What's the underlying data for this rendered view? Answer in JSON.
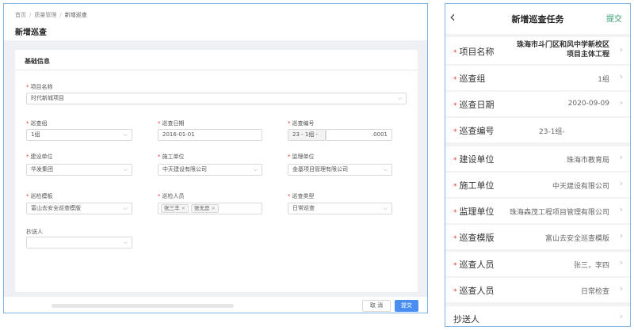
{
  "desktop": {
    "breadcrumb": [
      "首页",
      "质量管理",
      "新增巡查"
    ],
    "page_title": "新增巡查",
    "section_title": "基础信息",
    "fields": {
      "project": {
        "label": "项目名称",
        "value": "时代新城项目"
      },
      "group": {
        "label": "巡查组",
        "value": "1组"
      },
      "date": {
        "label": "巡查日期",
        "value": "2016-01-01"
      },
      "code": {
        "label": "巡查编号",
        "prefix": "23 - 1组 -",
        "suffix": ".0001"
      },
      "build_unit": {
        "label": "建设单位",
        "value": "华发集团"
      },
      "construct_unit": {
        "label": "施工单位",
        "value": "中天建设有限公司"
      },
      "supervise_unit": {
        "label": "监理单位",
        "value": "金基项目管理有限公司"
      },
      "template": {
        "label": "巡检模板",
        "value": "富山去安全巡查模版"
      },
      "inspectors": {
        "label": "巡检人员",
        "tags": [
          "张三丰",
          "张无忌"
        ]
      },
      "type": {
        "label": "巡查类型",
        "value": "日常巡查"
      },
      "cc": {
        "label": "抄送人",
        "value": ""
      }
    },
    "cancel_label": "取 消",
    "submit_label": "提交"
  },
  "mobile": {
    "title": "新增巡查任务",
    "submit_label": "提交",
    "rows": [
      {
        "label": "项目名称",
        "value": "珠海市斗门区和风中学新校区项目主体工程",
        "required": true
      },
      {
        "label": "巡查组",
        "value": "1组",
        "required": true
      },
      {
        "label": "巡查日期",
        "value": "2020-09-09",
        "required": true
      },
      {
        "label": "巡查编号",
        "value": "23-1组-",
        "required": true
      },
      {
        "label": "建设单位",
        "value": "珠海市教育局",
        "required": true
      },
      {
        "label": "施工单位",
        "value": "中天建设有限公司",
        "required": true
      },
      {
        "label": "监理单位",
        "value": "珠海森茂工程项目管理有限公司",
        "required": true
      },
      {
        "label": "巡查模版",
        "value": "富山去安全巡查模版",
        "required": true
      },
      {
        "label": "巡查人员",
        "value": "张三，李四",
        "required": true
      },
      {
        "label": "巡查人员",
        "value": "日常检查",
        "required": true
      },
      {
        "label": "抄送人",
        "value": "",
        "required": false
      }
    ]
  },
  "colors": {
    "accent": "#4a8df0",
    "required": "#e53935",
    "mobile_submit": "#2e9e6e",
    "frame": "#7fb2e6"
  },
  "icons": {
    "dropdown": "chevron-down-icon",
    "row_arrow": "chevron-right-icon",
    "back": "chevron-left-icon",
    "tag_close": "close-icon"
  }
}
